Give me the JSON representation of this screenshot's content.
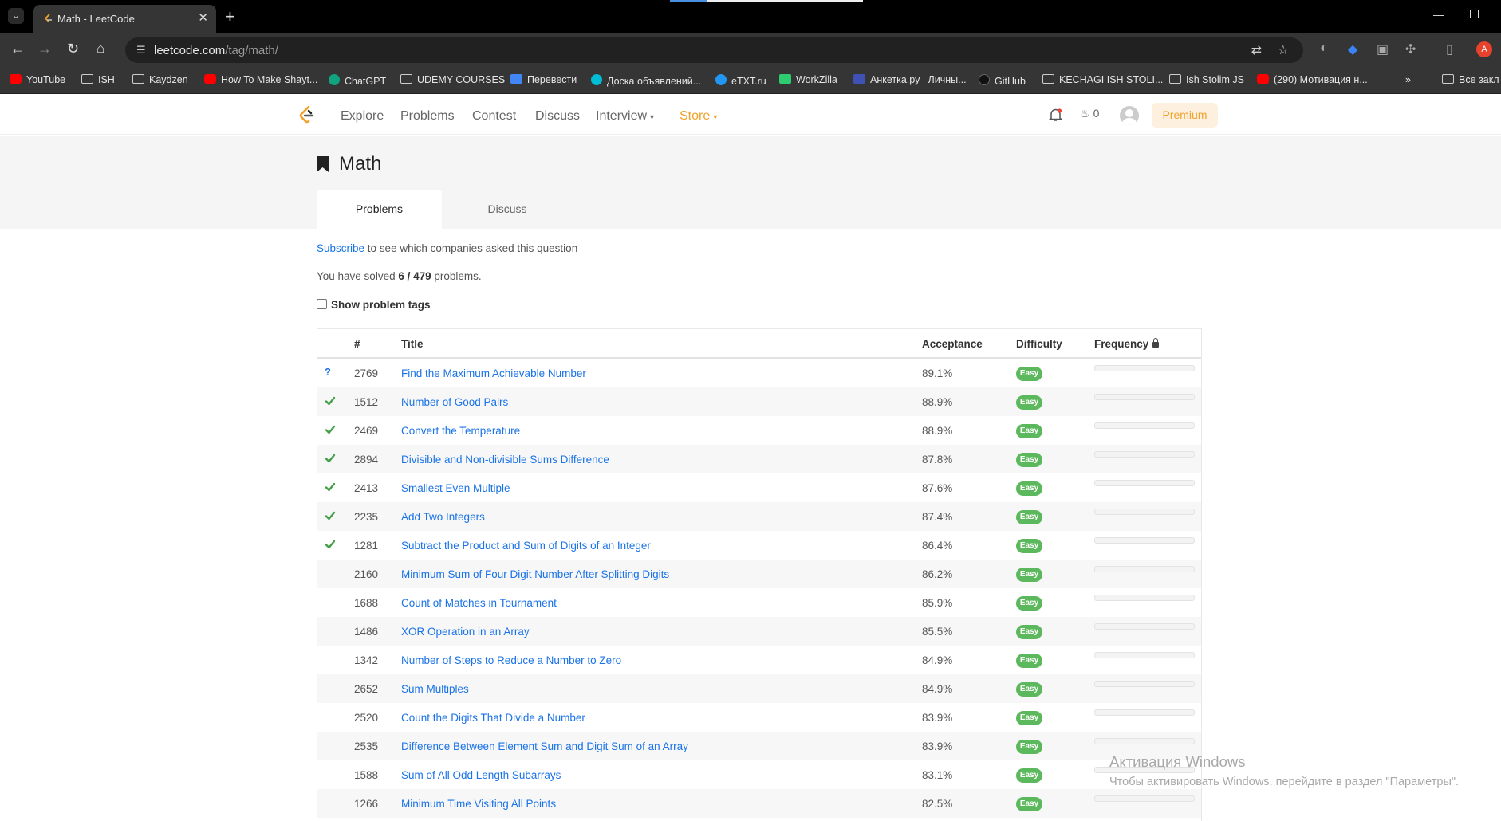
{
  "browser": {
    "tab_title": "Math - LeetCode",
    "url_host": "leetcode.com",
    "url_path": "/tag/math/",
    "profile_initial": "A",
    "bookmarks": [
      "YouTube",
      "ISH",
      "Kaydzen",
      "How To Make Shayt...",
      "ChatGPT",
      "UDEMY COURSES",
      "Перевести",
      "Доска объявлений...",
      "eTXT.ru",
      "WorkZilla",
      "Анкетка.ру | Личны...",
      "GitHub",
      "KECHAGI ISH STOLI...",
      "Ish Stolim JS",
      "(290) Мотивация н...",
      "Все закл"
    ]
  },
  "header": {
    "nav": [
      "Explore",
      "Problems",
      "Contest",
      "Discuss",
      "Interview",
      "Store"
    ],
    "streak_count": "0",
    "premium_label": "Premium"
  },
  "tag": {
    "title": "Math",
    "tabs": [
      "Problems",
      "Discuss"
    ],
    "subscribe_link": "Subscribe",
    "subscribe_text": " to see which companies asked this question",
    "solved_prefix": "You have solved ",
    "solved_count": "6 / 479",
    "solved_suffix": " problems.",
    "show_tags_label": "Show problem tags"
  },
  "table": {
    "columns": [
      "#",
      "Title",
      "Acceptance",
      "Difficulty",
      "Frequency"
    ],
    "rows": [
      {
        "status": "?",
        "num": "2769",
        "title": "Find the Maximum Achievable Number",
        "acceptance": "89.1%",
        "difficulty": "Easy"
      },
      {
        "status": "✔",
        "num": "1512",
        "title": "Number of Good Pairs",
        "acceptance": "88.9%",
        "difficulty": "Easy"
      },
      {
        "status": "✔",
        "num": "2469",
        "title": "Convert the Temperature",
        "acceptance": "88.9%",
        "difficulty": "Easy"
      },
      {
        "status": "✔",
        "num": "2894",
        "title": "Divisible and Non-divisible Sums Difference",
        "acceptance": "87.8%",
        "difficulty": "Easy"
      },
      {
        "status": "✔",
        "num": "2413",
        "title": "Smallest Even Multiple",
        "acceptance": "87.6%",
        "difficulty": "Easy"
      },
      {
        "status": "✔",
        "num": "2235",
        "title": "Add Two Integers",
        "acceptance": "87.4%",
        "difficulty": "Easy"
      },
      {
        "status": "✔",
        "num": "1281",
        "title": "Subtract the Product and Sum of Digits of an Integer",
        "acceptance": "86.4%",
        "difficulty": "Easy"
      },
      {
        "status": "",
        "num": "2160",
        "title": "Minimum Sum of Four Digit Number After Splitting Digits",
        "acceptance": "86.2%",
        "difficulty": "Easy"
      },
      {
        "status": "",
        "num": "1688",
        "title": "Count of Matches in Tournament",
        "acceptance": "85.9%",
        "difficulty": "Easy"
      },
      {
        "status": "",
        "num": "1486",
        "title": "XOR Operation in an Array",
        "acceptance": "85.5%",
        "difficulty": "Easy"
      },
      {
        "status": "",
        "num": "1342",
        "title": "Number of Steps to Reduce a Number to Zero",
        "acceptance": "84.9%",
        "difficulty": "Easy"
      },
      {
        "status": "",
        "num": "2652",
        "title": "Sum Multiples",
        "acceptance": "84.9%",
        "difficulty": "Easy"
      },
      {
        "status": "",
        "num": "2520",
        "title": "Count the Digits That Divide a Number",
        "acceptance": "83.9%",
        "difficulty": "Easy"
      },
      {
        "status": "",
        "num": "2535",
        "title": "Difference Between Element Sum and Digit Sum of an Array",
        "acceptance": "83.9%",
        "difficulty": "Easy"
      },
      {
        "status": "",
        "num": "1588",
        "title": "Sum of All Odd Length Subarrays",
        "acceptance": "83.1%",
        "difficulty": "Easy"
      },
      {
        "status": "",
        "num": "1266",
        "title": "Minimum Time Visiting All Points",
        "acceptance": "82.5%",
        "difficulty": "Easy"
      }
    ]
  },
  "watermark": {
    "line1": "Активация Windows",
    "line2": "Чтобы активировать Windows, перейдите в раздел \"Параметры\"."
  },
  "colors": {
    "link": "#1a73e8",
    "easy": "#5cb85c",
    "solved_check": "#43a047",
    "store": "#f0a22a"
  }
}
